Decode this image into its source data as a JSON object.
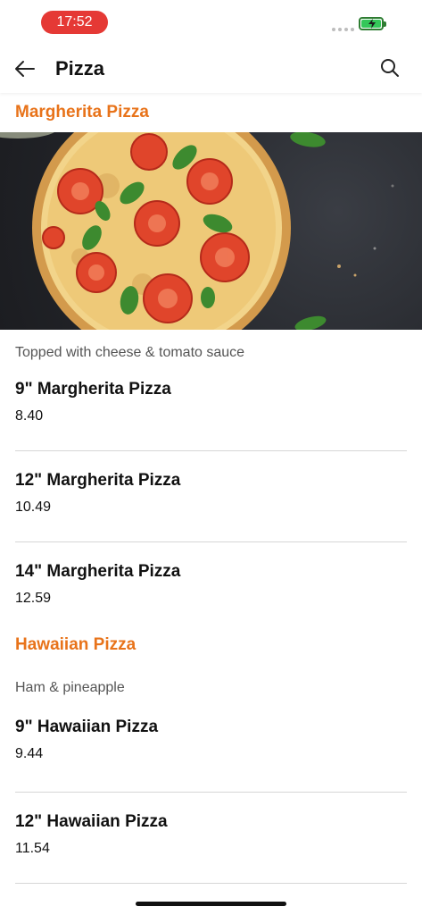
{
  "status": {
    "time": "17:52"
  },
  "header": {
    "title": "Pizza"
  },
  "sections": [
    {
      "title": "Margherita Pizza",
      "description": "Topped with cheese & tomato sauce",
      "items": [
        {
          "name": "9\" Margherita Pizza",
          "price": "8.40"
        },
        {
          "name": "12\" Margherita Pizza",
          "price": "10.49"
        },
        {
          "name": "14\" Margherita Pizza",
          "price": "12.59"
        }
      ]
    },
    {
      "title": "Hawaiian Pizza",
      "description": "Ham & pineapple",
      "items": [
        {
          "name": "9\" Hawaiian Pizza",
          "price": "9.44"
        },
        {
          "name": "12\" Hawaiian Pizza",
          "price": "11.54"
        }
      ]
    }
  ],
  "colors": {
    "accent": "#e8731a",
    "status_pill": "#e53935"
  },
  "icons": [
    "back-arrow-icon",
    "search-icon",
    "battery-charging-icon",
    "signal-dots-icon"
  ]
}
